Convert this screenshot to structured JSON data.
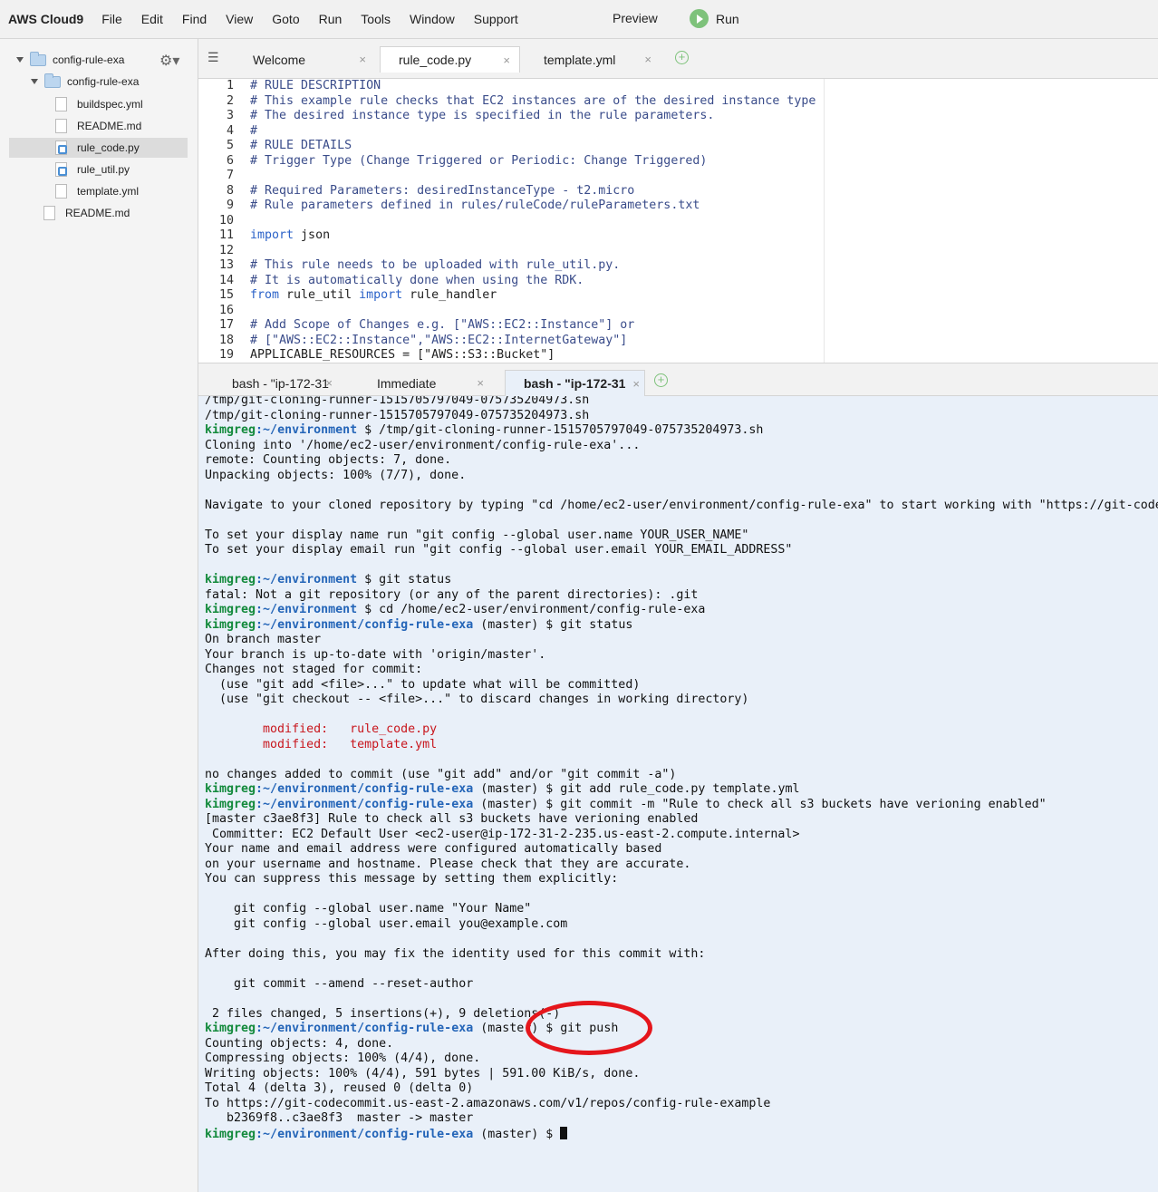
{
  "app": {
    "brand": "AWS Cloud9",
    "menu": [
      "File",
      "Edit",
      "Find",
      "View",
      "Goto",
      "Run",
      "Tools",
      "Window",
      "Support"
    ],
    "preview_label": "Preview",
    "run_label": "Run"
  },
  "sidebar": {
    "items": [
      {
        "label": "config-rule-exa",
        "type": "folder"
      },
      {
        "label": "config-rule-exa",
        "type": "folder"
      },
      {
        "label": "buildspec.yml",
        "type": "file"
      },
      {
        "label": "README.md",
        "type": "file"
      },
      {
        "label": "rule_code.py",
        "type": "py",
        "selected": true
      },
      {
        "label": "rule_util.py",
        "type": "py"
      },
      {
        "label": "template.yml",
        "type": "file"
      },
      {
        "label": "README.md",
        "type": "file"
      }
    ]
  },
  "editor_tabs": [
    {
      "label": "Welcome",
      "close": "×"
    },
    {
      "label": "rule_code.py",
      "close": "×"
    },
    {
      "label": "template.yml",
      "close": "×"
    }
  ],
  "editor": {
    "lines": [
      {
        "n": "1",
        "t": "# RULE DESCRIPTION"
      },
      {
        "n": "2",
        "t": "# This example rule checks that EC2 instances are of the desired instance type"
      },
      {
        "n": "3",
        "t": "# The desired instance type is specified in the rule parameters."
      },
      {
        "n": "4",
        "t": "#"
      },
      {
        "n": "5",
        "t": "# RULE DETAILS"
      },
      {
        "n": "6",
        "t": "# Trigger Type (Change Triggered or Periodic: Change Triggered)"
      },
      {
        "n": "7",
        "t": ""
      },
      {
        "n": "8",
        "t": "# Required Parameters: desiredInstanceType - t2.micro"
      },
      {
        "n": "9",
        "t": "# Rule parameters defined in rules/ruleCode/ruleParameters.txt"
      },
      {
        "n": "10",
        "t": ""
      },
      {
        "n": "11",
        "kw": "import",
        "rest": " json"
      },
      {
        "n": "12",
        "t": ""
      },
      {
        "n": "13",
        "t": "# This rule needs to be uploaded with rule_util.py."
      },
      {
        "n": "14",
        "t": "# It is automatically done when using the RDK."
      },
      {
        "n": "15",
        "kw": "from",
        "mid": " rule_util ",
        "kw2": "import",
        "rest": " rule_handler"
      },
      {
        "n": "16",
        "t": ""
      },
      {
        "n": "17",
        "t": "# Add Scope of Changes e.g. [\"AWS::EC2::Instance\"] or"
      },
      {
        "n": "18",
        "t": "# [\"AWS::EC2::Instance\",\"AWS::EC2::InternetGateway\"]"
      },
      {
        "n": "19",
        "plain": "APPLICABLE_RESOURCES = [\"AWS::S3::Bucket\"]"
      }
    ]
  },
  "terminal_tabs": [
    {
      "label": "bash - \"ip-172-31",
      "close": "×"
    },
    {
      "label": "Immediate",
      "close": "×"
    },
    {
      "label": "bash - \"ip-172-31",
      "close": "×"
    }
  ],
  "terminal": {
    "user": "kimgreg",
    "lines": [
      {
        "t": "/tmp/git-cloning-runner-1515705797049-075735204973.sh"
      },
      {
        "t": "/tmp/git-cloning-runner-1515705797049-075735204973.sh"
      },
      {
        "p": ":~/environment",
        "c": " $ /tmp/git-cloning-runner-1515705797049-075735204973.sh"
      },
      {
        "t": "Cloning into '/home/ec2-user/environment/config-rule-exa'..."
      },
      {
        "t": "remote: Counting objects: 7, done."
      },
      {
        "t": "Unpacking objects: 100% (7/7), done."
      },
      {
        "t": ""
      },
      {
        "t": "Navigate to your cloned repository by typing \"cd /home/ec2-user/environment/config-rule-exa\" to start working with \"https://git-codecommit"
      },
      {
        "t": ""
      },
      {
        "t": "To set your display name run \"git config --global user.name YOUR_USER_NAME\""
      },
      {
        "t": "To set your display email run \"git config --global user.email YOUR_EMAIL_ADDRESS\""
      },
      {
        "t": ""
      },
      {
        "p": ":~/environment",
        "c": " $ git status"
      },
      {
        "t": "fatal: Not a git repository (or any of the parent directories): .git"
      },
      {
        "p": ":~/environment",
        "c": " $ cd /home/ec2-user/environment/config-rule-exa"
      },
      {
        "p": ":~/environment/config-rule-exa",
        "c": " (master) $ git status"
      },
      {
        "t": "On branch master"
      },
      {
        "t": "Your branch is up-to-date with 'origin/master'."
      },
      {
        "t": "Changes not staged for commit:"
      },
      {
        "t": "  (use \"git add <file>...\" to update what will be committed)"
      },
      {
        "t": "  (use \"git checkout -- <file>...\" to discard changes in working directory)"
      },
      {
        "t": ""
      },
      {
        "r": "        modified:   rule_code.py"
      },
      {
        "r": "        modified:   template.yml"
      },
      {
        "t": ""
      },
      {
        "t": "no changes added to commit (use \"git add\" and/or \"git commit -a\")"
      },
      {
        "p": ":~/environment/config-rule-exa",
        "c": " (master) $ git add rule_code.py template.yml"
      },
      {
        "p": ":~/environment/config-rule-exa",
        "c": " (master) $ git commit -m \"Rule to check all s3 buckets have verioning enabled\""
      },
      {
        "t": "[master c3ae8f3] Rule to check all s3 buckets have verioning enabled"
      },
      {
        "t": " Committer: EC2 Default User <ec2-user@ip-172-31-2-235.us-east-2.compute.internal>"
      },
      {
        "t": "Your name and email address were configured automatically based"
      },
      {
        "t": "on your username and hostname. Please check that they are accurate."
      },
      {
        "t": "You can suppress this message by setting them explicitly:"
      },
      {
        "t": ""
      },
      {
        "t": "    git config --global user.name \"Your Name\""
      },
      {
        "t": "    git config --global user.email you@example.com"
      },
      {
        "t": ""
      },
      {
        "t": "After doing this, you may fix the identity used for this commit with:"
      },
      {
        "t": ""
      },
      {
        "t": "    git commit --amend --reset-author"
      },
      {
        "t": ""
      },
      {
        "t": " 2 files changed, 5 insertions(+), 9 deletions(-)"
      },
      {
        "p": ":~/environment/config-rule-exa",
        "c": " (master) $ git push"
      },
      {
        "t": "Counting objects: 4, done."
      },
      {
        "t": "Compressing objects: 100% (4/4), done."
      },
      {
        "t": "Writing objects: 100% (4/4), 591 bytes | 591.00 KiB/s, done."
      },
      {
        "t": "Total 4 (delta 3), reused 0 (delta 0)"
      },
      {
        "t": "To https://git-codecommit.us-east-2.amazonaws.com/v1/repos/config-rule-example"
      },
      {
        "t": "   b2369f8..c3ae8f3  master -> master"
      },
      {
        "p": ":~/environment/config-rule-exa",
        "c": " (master) $ ",
        "cursor": true
      }
    ]
  },
  "colors": {
    "user_green": "#138a3c",
    "path_blue": "#2465b8",
    "modified_red": "#c8161d",
    "highlight_red": "#e5161c",
    "terminal_bg": "#e9f0f9"
  }
}
